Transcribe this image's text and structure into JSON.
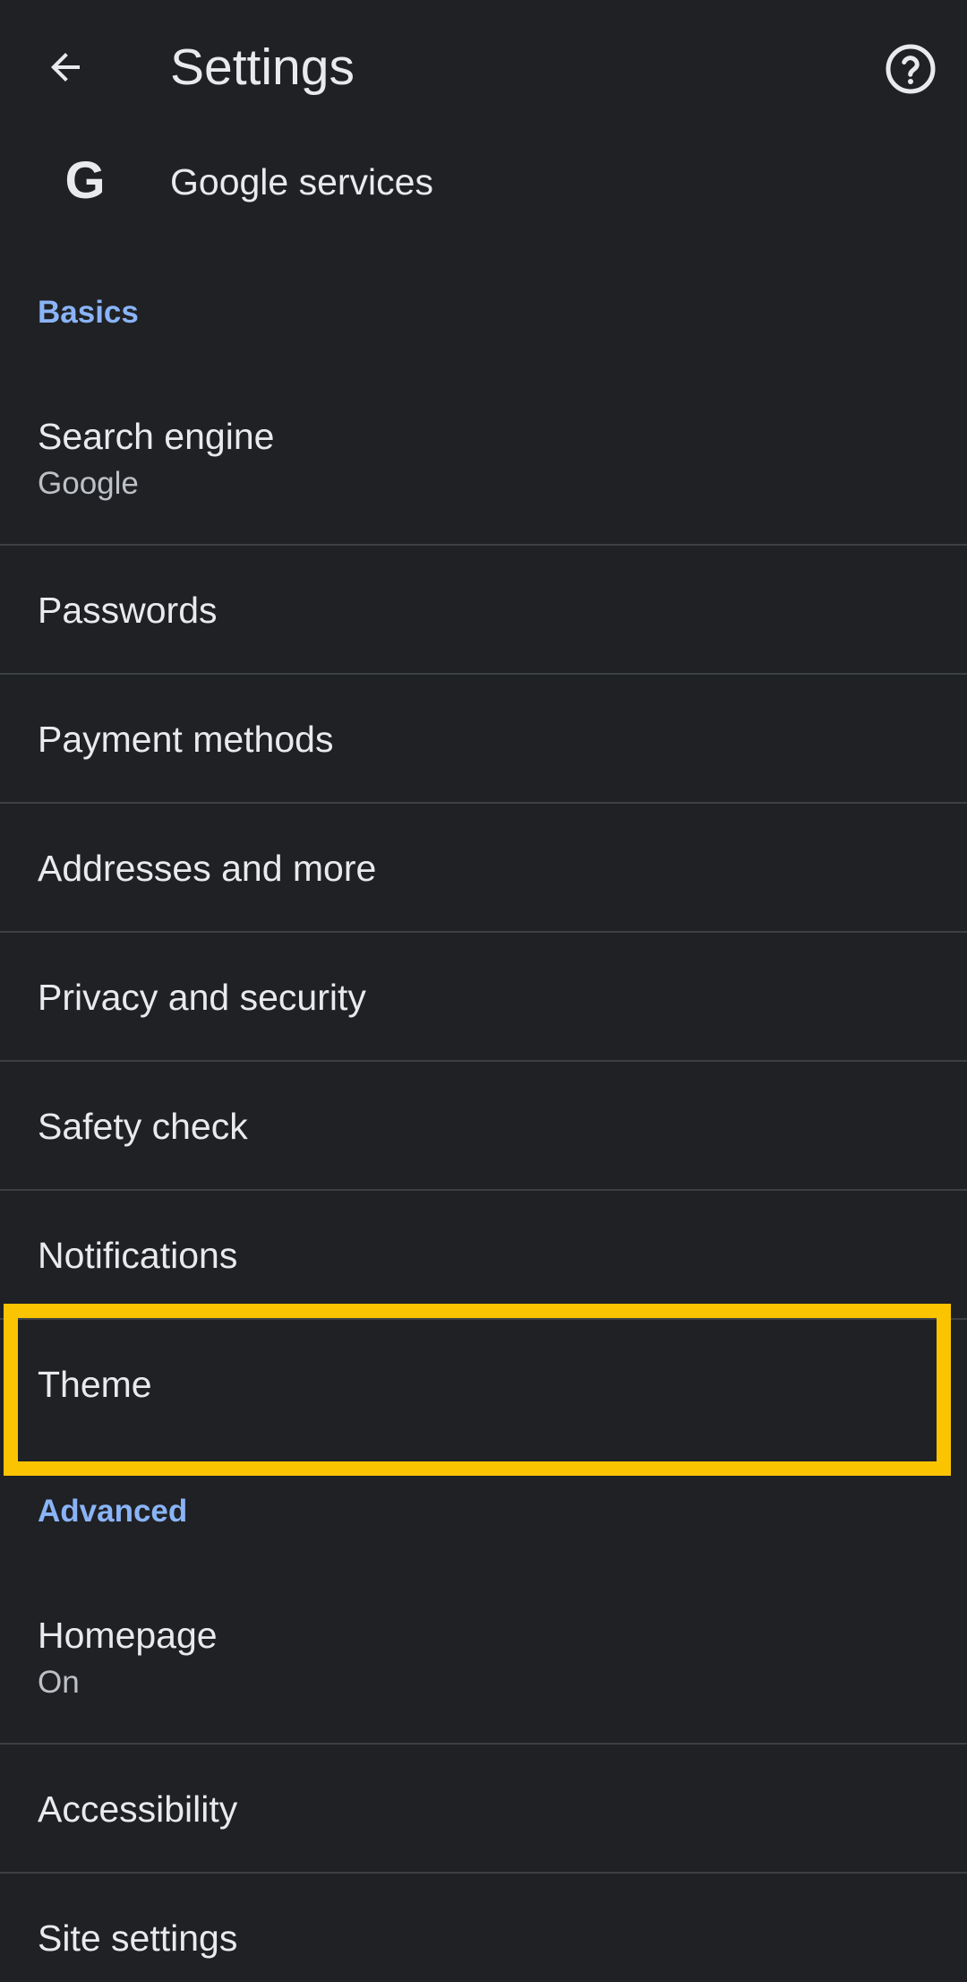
{
  "header": {
    "title": "Settings",
    "back_icon": "arrow-back-icon",
    "help_icon": "help-circle-icon"
  },
  "google_services": {
    "icon": "google-g-icon",
    "icon_glyph": "G",
    "label": "Google services"
  },
  "sections": {
    "basics": "Basics",
    "advanced": "Advanced"
  },
  "items": {
    "search_engine": {
      "title": "Search engine",
      "subtitle": "Google"
    },
    "passwords": {
      "title": "Passwords"
    },
    "payment_methods": {
      "title": "Payment methods"
    },
    "addresses": {
      "title": "Addresses and more"
    },
    "privacy": {
      "title": "Privacy and security"
    },
    "safety_check": {
      "title": "Safety check"
    },
    "notifications": {
      "title": "Notifications"
    },
    "theme": {
      "title": "Theme"
    },
    "homepage": {
      "title": "Homepage",
      "subtitle": "On"
    },
    "accessibility": {
      "title": "Accessibility"
    },
    "site_settings": {
      "title": "Site settings"
    }
  },
  "colors": {
    "background": "#202124",
    "accent": "#8ab4f8",
    "highlight": "#fbc400",
    "divider": "#3c4043"
  }
}
